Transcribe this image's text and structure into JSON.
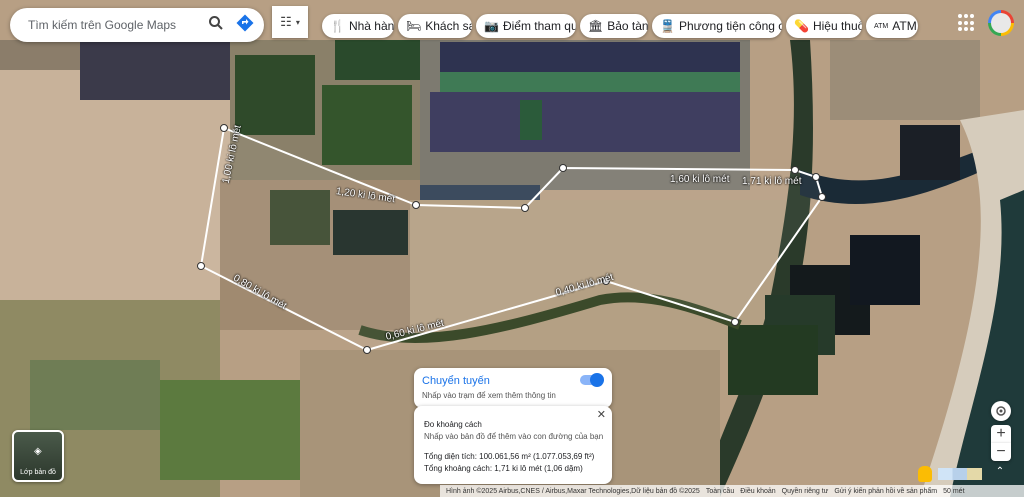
{
  "search": {
    "placeholder": "Tìm kiếm trên Google Maps",
    "icon": "search-icon",
    "directions_icon": "directions-icon"
  },
  "categories": [
    {
      "label": "Nhà hàng",
      "icon": "restaurant-icon"
    },
    {
      "label": "Khách sạn",
      "icon": "hotel-icon"
    },
    {
      "label": "Điểm tham quan",
      "icon": "camera-icon"
    },
    {
      "label": "Bảo tàng",
      "icon": "museum-icon"
    },
    {
      "label": "Phương tiện công cộ...",
      "icon": "transit-icon"
    },
    {
      "label": "Hiệu thuốc",
      "icon": "pharmacy-icon"
    },
    {
      "label": "ATM",
      "icon": "atm-icon"
    }
  ],
  "distance_labels": [
    "1,00 ki lô mét",
    "1,20 ki lô mét",
    "1,60 ki lô mét",
    "1,71 ki lô mét",
    "0,80 ki lô mét",
    "0,60 ki lô mét",
    "0,40 ki lô mét"
  ],
  "route_panel": {
    "title": "Chuyển tuyến",
    "subtitle": "Nhấp vào trạm để xem thêm thông tin"
  },
  "measure_panel": {
    "title": "Đo khoảng cách",
    "hint": "Nhấp vào bản đồ để thêm vào con đường của bạn",
    "area": "Tổng diện tích: 100.061,56 m² (1.077.053,69 ft²)",
    "total": "Tổng khoảng cách: 1,71 ki lô mét (1,06 dặm)"
  },
  "layers": {
    "label": "Lớp bản đồ"
  },
  "attribution": [
    "Hình ảnh ©2025 Airbus,CNES / Airbus,Maxar Technologies,Dữ liệu bản đồ ©2025",
    "Toàn cầu",
    "Điều khoản",
    "Quyền riêng tư",
    "Gửi ý kiến phản hồi về sản phẩm",
    "50 mét"
  ],
  "colors": {
    "accent": "#1a73e8",
    "route": "#ffffff"
  }
}
